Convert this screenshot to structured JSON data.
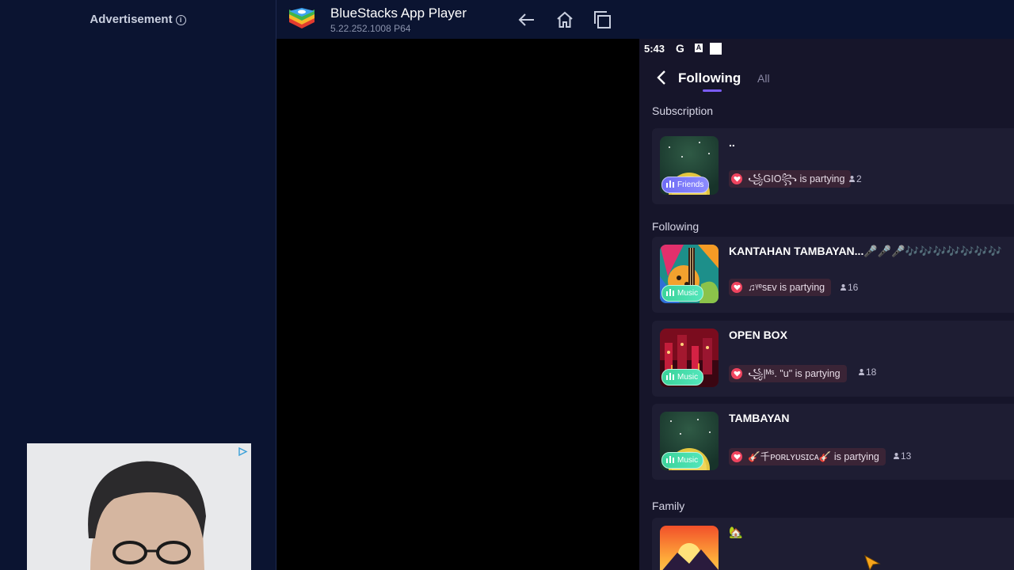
{
  "ad": {
    "label": "Advertisement",
    "info_icon": "info-icon"
  },
  "titlebar": {
    "app_name": "BlueStacks App Player",
    "version": "5.22.252.1008",
    "arch": "P64",
    "version_line": "5.22.252.1008  P64",
    "buttons": [
      "back-arrow-icon",
      "home-icon",
      "recent-apps-icon"
    ]
  },
  "status_bar": {
    "time": "5:43",
    "g_icon": "G"
  },
  "nav": {
    "tab_following": "Following",
    "tab_all": "All",
    "active_tab": "Following"
  },
  "sections": {
    "subscription": "Subscription",
    "following": "Following",
    "family": "Family"
  },
  "rooms": {
    "subscription": {
      "name": "..",
      "badge": "Friends",
      "host": "꧁GIO꧂",
      "status": "is partying",
      "listeners": "2"
    },
    "kantahan": {
      "name": "KANTAHAN TAMBAYAN...🎤🎤🎤🎶🎶🎶🎶🎶🎶🎶",
      "badge": "Music",
      "host": "♫ᵞᵉsᴇᴠ",
      "status": "is partying",
      "listeners": "16"
    },
    "openbox": {
      "name": "OPEN BOX",
      "badge": "Music",
      "host": "꧁|ᴹˢ. \"u\"",
      "status": "is partying",
      "listeners": "18"
    },
    "tambayan": {
      "name": "TAMBAYAN",
      "badge": "Music",
      "host": "🎸千ᴘᴏʀʟʏᴜsɪᴄᴀ🎸",
      "status": "is partying",
      "listeners": "13"
    },
    "family": {
      "name": "🏡"
    }
  },
  "colors": {
    "sidebar_bg": "#0b1431",
    "phone_bg": "#16152a",
    "card_bg": "#1e1d33",
    "accent": "#7a5cf6",
    "friends_badge": "#7b79f8",
    "music_badge": "#46dcaa",
    "heart": "#f0445f"
  }
}
